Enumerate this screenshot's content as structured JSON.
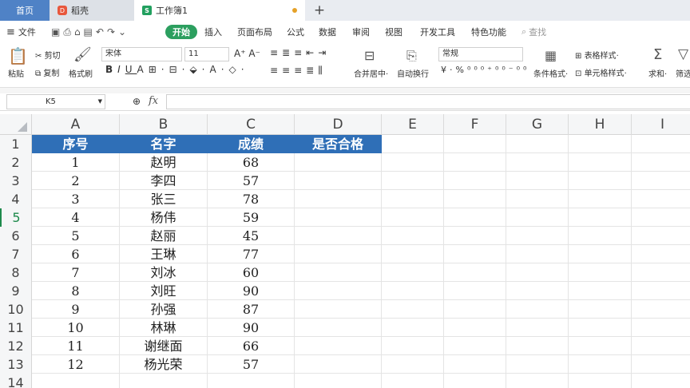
{
  "tabs": {
    "home": "首页",
    "daoke": "稻壳",
    "workbook": "工作簿1",
    "add": "+"
  },
  "menu": {
    "file": "文件",
    "items": [
      "开始",
      "插入",
      "页面布局",
      "公式",
      "数据",
      "审阅",
      "视图",
      "开发工具",
      "特色功能"
    ],
    "search": "查找"
  },
  "ribbon": {
    "paste": "粘贴",
    "cut": "剪切",
    "copy": "复制",
    "format_painter": "格式刷",
    "font_name": "宋体",
    "font_size": "11",
    "merge_center": "合并居中",
    "wrap_text": "自动换行",
    "number_format": "常规",
    "conditional_format": "条件格式",
    "table_style": "表格样式",
    "cell_style": "单元格样式",
    "sum": "求和",
    "filter": "筛选"
  },
  "formula_bar": {
    "cell_ref": "K5",
    "fx": "fx",
    "content": ""
  },
  "sheet": {
    "columns": [
      "A",
      "B",
      "C",
      "D",
      "E",
      "F",
      "G",
      "H",
      "I"
    ],
    "header_row": [
      "序号",
      "名字",
      "成绩",
      "是否合格"
    ],
    "rows": [
      {
        "num": "2",
        "a": "1",
        "b": "赵明",
        "c": "68"
      },
      {
        "num": "3",
        "a": "2",
        "b": "李四",
        "c": "57"
      },
      {
        "num": "4",
        "a": "3",
        "b": "张三",
        "c": "78"
      },
      {
        "num": "5",
        "a": "4",
        "b": "杨伟",
        "c": "59"
      },
      {
        "num": "6",
        "a": "5",
        "b": "赵丽",
        "c": "45"
      },
      {
        "num": "7",
        "a": "6",
        "b": "王琳",
        "c": "77"
      },
      {
        "num": "8",
        "a": "7",
        "b": "刘冰",
        "c": "60"
      },
      {
        "num": "9",
        "a": "8",
        "b": "刘旺",
        "c": "90"
      },
      {
        "num": "10",
        "a": "9",
        "b": "孙强",
        "c": "87"
      },
      {
        "num": "11",
        "a": "10",
        "b": "林琳",
        "c": "90"
      },
      {
        "num": "12",
        "a": "11",
        "b": "谢继面",
        "c": "66"
      },
      {
        "num": "13",
        "a": "12",
        "b": "杨光荣",
        "c": "57"
      }
    ],
    "row_numbers": {
      "first": "1",
      "last": "14"
    },
    "active_row": "5"
  },
  "colors": {
    "header_fill": "#2f6fb7",
    "accent_green": "#2c9f5f",
    "home_tab": "#4f82c6"
  }
}
